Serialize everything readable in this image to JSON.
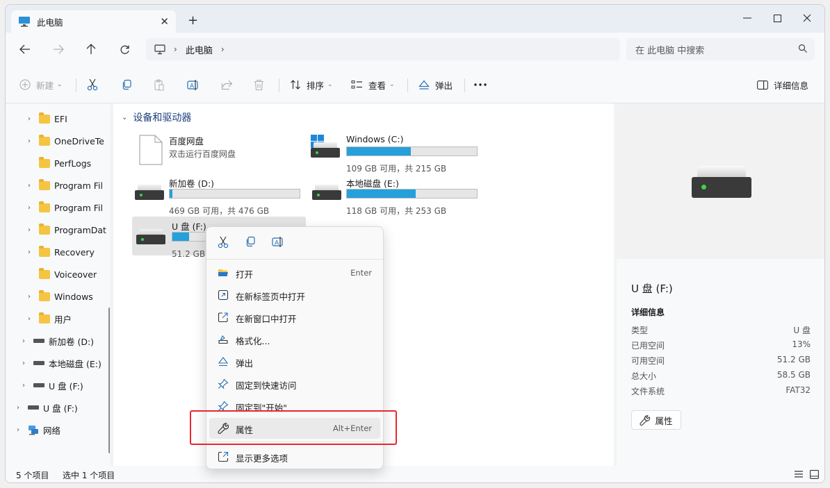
{
  "tab": {
    "title": "此电脑"
  },
  "address": {
    "crumbs": [
      "此电脑"
    ]
  },
  "search": {
    "placeholder": "在 此电脑 中搜索"
  },
  "toolbar": {
    "new_label": "新建",
    "sort_label": "排序",
    "view_label": "查看",
    "eject_label": "弹出",
    "details_label": "详细信息"
  },
  "sidebar": {
    "items": [
      {
        "label": "EFI",
        "type": "folder",
        "expandable": true
      },
      {
        "label": "OneDriveTe",
        "type": "folder",
        "expandable": true
      },
      {
        "label": "PerfLogs",
        "type": "folder",
        "expandable": false
      },
      {
        "label": "Program Fil",
        "type": "folder",
        "expandable": true
      },
      {
        "label": "Program Fil",
        "type": "folder",
        "expandable": true
      },
      {
        "label": "ProgramDat",
        "type": "folder",
        "expandable": true
      },
      {
        "label": "Recovery",
        "type": "folder",
        "expandable": true
      },
      {
        "label": "Voiceover",
        "type": "folder",
        "expandable": false
      },
      {
        "label": "Windows",
        "type": "folder",
        "expandable": true
      },
      {
        "label": "用户",
        "type": "folder",
        "expandable": true
      },
      {
        "label": "新加卷 (D:)",
        "type": "drive",
        "expandable": true
      },
      {
        "label": "本地磁盘 (E:)",
        "type": "drive",
        "expandable": true
      },
      {
        "label": "U 盘 (F:)",
        "type": "drive",
        "expandable": true
      },
      {
        "label": "U 盘 (F:)",
        "type": "drive",
        "expandable": true
      },
      {
        "label": "网络",
        "type": "network",
        "expandable": true
      }
    ]
  },
  "content": {
    "group_title": "设备和驱动器",
    "drives": [
      {
        "name": "百度网盘",
        "sub": "双击运行百度网盘",
        "icon": "file-icon",
        "used_fraction": null
      },
      {
        "name": "Windows (C:)",
        "sub": "109 GB 可用，共 215 GB",
        "icon": "windows-drive-icon",
        "used_fraction": 0.49
      },
      {
        "name": "新加卷 (D:)",
        "sub": "469 GB 可用，共 476 GB",
        "icon": "hdd-icon",
        "used_fraction": 0.02
      },
      {
        "name": "本地磁盘 (E:)",
        "sub": "118 GB 可用，共 253 GB",
        "icon": "hdd-icon",
        "used_fraction": 0.53
      },
      {
        "name": "U 盘 (F:)",
        "sub": "51.2 GB 可",
        "icon": "hdd-icon",
        "used_fraction": 0.13
      }
    ]
  },
  "details_pane": {
    "title": "U 盘 (F:)",
    "section": "详细信息",
    "props": [
      {
        "key": "类型",
        "value": "U 盘"
      },
      {
        "key": "已用空间",
        "value": "13%"
      },
      {
        "key": "可用空间",
        "value": "51.2 GB"
      },
      {
        "key": "总大小",
        "value": "58.5 GB"
      },
      {
        "key": "文件系统",
        "value": "FAT32"
      }
    ],
    "properties_button": "属性"
  },
  "status": {
    "count": "5 个项目",
    "selected": "选中 1 个项目"
  },
  "context_menu": {
    "items": [
      {
        "label": "打开",
        "shortcut": "Enter",
        "icon": "folder-open-icon"
      },
      {
        "label": "在新标签页中打开",
        "shortcut": "",
        "icon": "new-tab-icon"
      },
      {
        "label": "在新窗口中打开",
        "shortcut": "",
        "icon": "new-window-icon"
      },
      {
        "label": "格式化...",
        "shortcut": "",
        "icon": "format-icon"
      },
      {
        "label": "弹出",
        "shortcut": "",
        "icon": "eject-icon"
      },
      {
        "label": "固定到快速访问",
        "shortcut": "",
        "icon": "pin-icon"
      },
      {
        "label": "固定到\"开始\"",
        "shortcut": "",
        "icon": "pin-icon"
      },
      {
        "label": "属性",
        "shortcut": "Alt+Enter",
        "icon": "wrench-icon"
      },
      {
        "label": "显示更多选项",
        "shortcut": "",
        "icon": "more-options-icon"
      }
    ]
  },
  "colors": {
    "accent": "#26a0da",
    "highlight_box": "#e8262e",
    "link_blue": "#1c3f7a"
  }
}
